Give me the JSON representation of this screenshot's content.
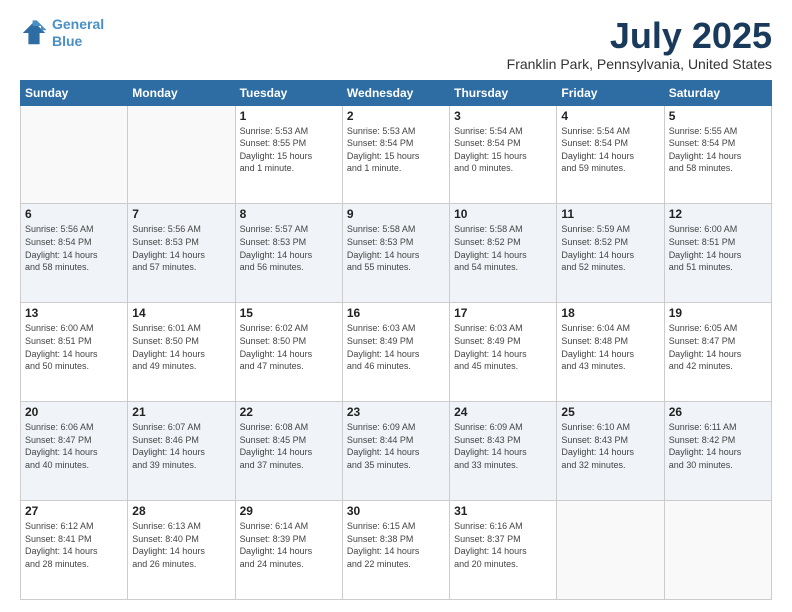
{
  "logo": {
    "line1": "General",
    "line2": "Blue"
  },
  "title": "July 2025",
  "location": "Franklin Park, Pennsylvania, United States",
  "days_of_week": [
    "Sunday",
    "Monday",
    "Tuesday",
    "Wednesday",
    "Thursday",
    "Friday",
    "Saturday"
  ],
  "weeks": [
    [
      {
        "day": "",
        "info": ""
      },
      {
        "day": "",
        "info": ""
      },
      {
        "day": "1",
        "info": "Sunrise: 5:53 AM\nSunset: 8:55 PM\nDaylight: 15 hours\nand 1 minute."
      },
      {
        "day": "2",
        "info": "Sunrise: 5:53 AM\nSunset: 8:54 PM\nDaylight: 15 hours\nand 1 minute."
      },
      {
        "day": "3",
        "info": "Sunrise: 5:54 AM\nSunset: 8:54 PM\nDaylight: 15 hours\nand 0 minutes."
      },
      {
        "day": "4",
        "info": "Sunrise: 5:54 AM\nSunset: 8:54 PM\nDaylight: 14 hours\nand 59 minutes."
      },
      {
        "day": "5",
        "info": "Sunrise: 5:55 AM\nSunset: 8:54 PM\nDaylight: 14 hours\nand 58 minutes."
      }
    ],
    [
      {
        "day": "6",
        "info": "Sunrise: 5:56 AM\nSunset: 8:54 PM\nDaylight: 14 hours\nand 58 minutes."
      },
      {
        "day": "7",
        "info": "Sunrise: 5:56 AM\nSunset: 8:53 PM\nDaylight: 14 hours\nand 57 minutes."
      },
      {
        "day": "8",
        "info": "Sunrise: 5:57 AM\nSunset: 8:53 PM\nDaylight: 14 hours\nand 56 minutes."
      },
      {
        "day": "9",
        "info": "Sunrise: 5:58 AM\nSunset: 8:53 PM\nDaylight: 14 hours\nand 55 minutes."
      },
      {
        "day": "10",
        "info": "Sunrise: 5:58 AM\nSunset: 8:52 PM\nDaylight: 14 hours\nand 54 minutes."
      },
      {
        "day": "11",
        "info": "Sunrise: 5:59 AM\nSunset: 8:52 PM\nDaylight: 14 hours\nand 52 minutes."
      },
      {
        "day": "12",
        "info": "Sunrise: 6:00 AM\nSunset: 8:51 PM\nDaylight: 14 hours\nand 51 minutes."
      }
    ],
    [
      {
        "day": "13",
        "info": "Sunrise: 6:00 AM\nSunset: 8:51 PM\nDaylight: 14 hours\nand 50 minutes."
      },
      {
        "day": "14",
        "info": "Sunrise: 6:01 AM\nSunset: 8:50 PM\nDaylight: 14 hours\nand 49 minutes."
      },
      {
        "day": "15",
        "info": "Sunrise: 6:02 AM\nSunset: 8:50 PM\nDaylight: 14 hours\nand 47 minutes."
      },
      {
        "day": "16",
        "info": "Sunrise: 6:03 AM\nSunset: 8:49 PM\nDaylight: 14 hours\nand 46 minutes."
      },
      {
        "day": "17",
        "info": "Sunrise: 6:03 AM\nSunset: 8:49 PM\nDaylight: 14 hours\nand 45 minutes."
      },
      {
        "day": "18",
        "info": "Sunrise: 6:04 AM\nSunset: 8:48 PM\nDaylight: 14 hours\nand 43 minutes."
      },
      {
        "day": "19",
        "info": "Sunrise: 6:05 AM\nSunset: 8:47 PM\nDaylight: 14 hours\nand 42 minutes."
      }
    ],
    [
      {
        "day": "20",
        "info": "Sunrise: 6:06 AM\nSunset: 8:47 PM\nDaylight: 14 hours\nand 40 minutes."
      },
      {
        "day": "21",
        "info": "Sunrise: 6:07 AM\nSunset: 8:46 PM\nDaylight: 14 hours\nand 39 minutes."
      },
      {
        "day": "22",
        "info": "Sunrise: 6:08 AM\nSunset: 8:45 PM\nDaylight: 14 hours\nand 37 minutes."
      },
      {
        "day": "23",
        "info": "Sunrise: 6:09 AM\nSunset: 8:44 PM\nDaylight: 14 hours\nand 35 minutes."
      },
      {
        "day": "24",
        "info": "Sunrise: 6:09 AM\nSunset: 8:43 PM\nDaylight: 14 hours\nand 33 minutes."
      },
      {
        "day": "25",
        "info": "Sunrise: 6:10 AM\nSunset: 8:43 PM\nDaylight: 14 hours\nand 32 minutes."
      },
      {
        "day": "26",
        "info": "Sunrise: 6:11 AM\nSunset: 8:42 PM\nDaylight: 14 hours\nand 30 minutes."
      }
    ],
    [
      {
        "day": "27",
        "info": "Sunrise: 6:12 AM\nSunset: 8:41 PM\nDaylight: 14 hours\nand 28 minutes."
      },
      {
        "day": "28",
        "info": "Sunrise: 6:13 AM\nSunset: 8:40 PM\nDaylight: 14 hours\nand 26 minutes."
      },
      {
        "day": "29",
        "info": "Sunrise: 6:14 AM\nSunset: 8:39 PM\nDaylight: 14 hours\nand 24 minutes."
      },
      {
        "day": "30",
        "info": "Sunrise: 6:15 AM\nSunset: 8:38 PM\nDaylight: 14 hours\nand 22 minutes."
      },
      {
        "day": "31",
        "info": "Sunrise: 6:16 AM\nSunset: 8:37 PM\nDaylight: 14 hours\nand 20 minutes."
      },
      {
        "day": "",
        "info": ""
      },
      {
        "day": "",
        "info": ""
      }
    ]
  ]
}
